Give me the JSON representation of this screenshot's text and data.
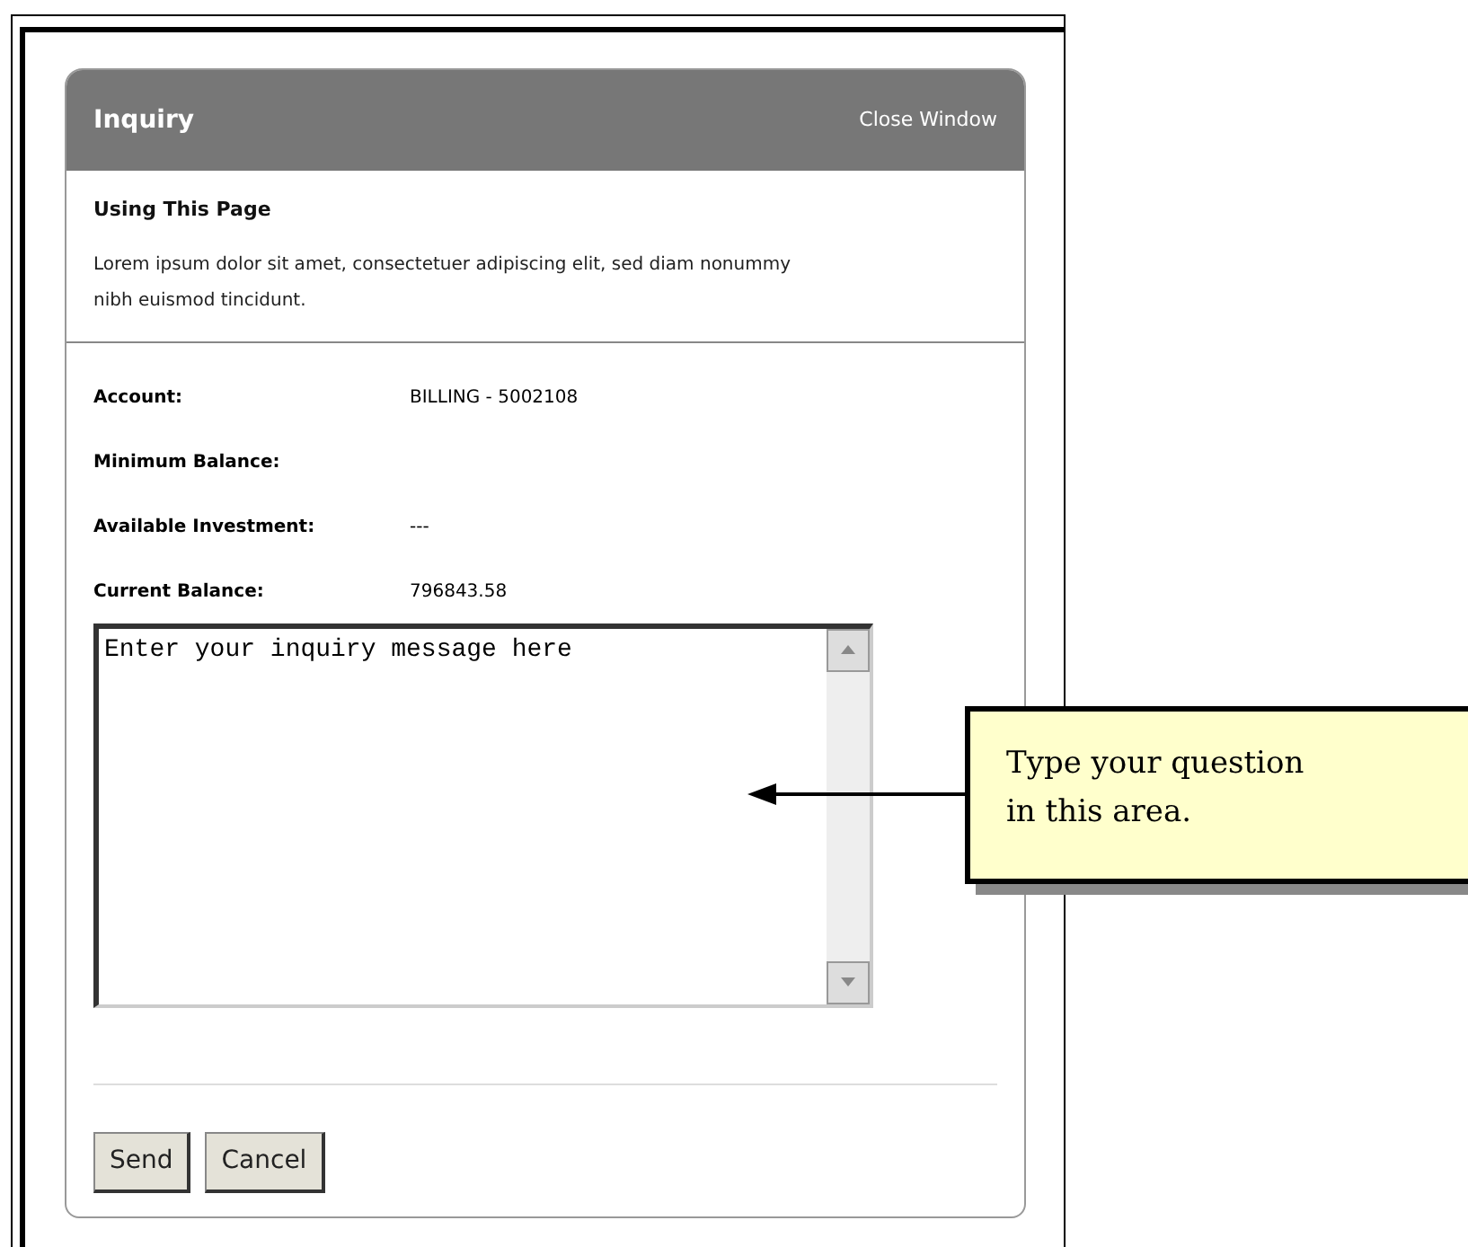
{
  "dialog": {
    "title": "Inquiry",
    "close_link": "Close Window"
  },
  "intro": {
    "heading": "Using This Page",
    "text": "Lorem ipsum dolor sit amet, consectetuer adipiscing elit, sed diam nonummy nibh euismod tincidunt."
  },
  "fields": [
    {
      "label": "Account:",
      "value": "BILLING - 5002108"
    },
    {
      "label": "Minimum Balance:"
    },
    {
      "label": "Available Investment:",
      "value": "---"
    },
    {
      "label": "Current Balance:",
      "value": "796843.58"
    }
  ],
  "message": {
    "value": "Enter your inquiry message here"
  },
  "buttons": [
    "Send",
    "Cancel"
  ],
  "callout": {
    "text": "Type your question in this area."
  }
}
